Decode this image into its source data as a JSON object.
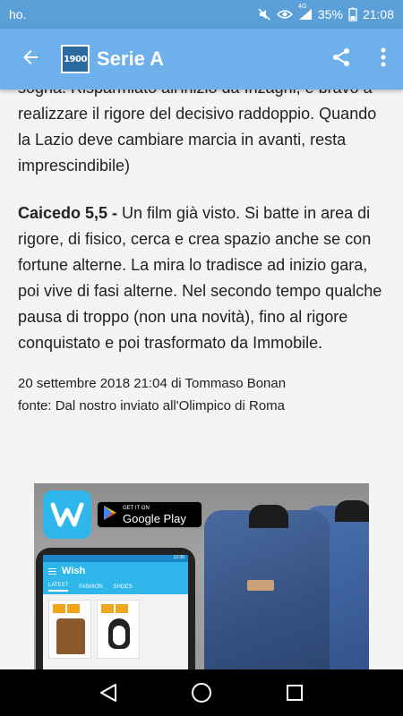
{
  "status_bar": {
    "carrier": "ho.",
    "network": "4G",
    "battery": "35%",
    "time": "21:08"
  },
  "app_bar": {
    "logo_text": "1900",
    "title": "Serie A"
  },
  "article": {
    "para1": "sogna. Risparmiato all'inizio da Inzaghi, è bravo a realizzare il rigore del decisivo raddoppio. Quando la Lazio deve cambiare marcia in avanti, resta imprescindibile)",
    "para2_name": "Caicedo 5,5 -",
    "para2_text": " Un film già visto. Si batte in area di rigore, di fisico, cerca e crea spazio anche se con fortune alterne. La mira lo tradisce ad inizio gara, poi vive di fasi alterne. Nel secondo tempo qualche pausa di troppo (non una novità), fino al rigore conquistato e poi trasformato da Immobile.",
    "meta_date_author": "20 settembre 2018 21:04 di Tommaso Bonan",
    "meta_source": "fonte: Dal nostro inviato all'Olimpico di Roma"
  },
  "ad": {
    "gplay_small": "GET IT ON",
    "gplay_big": "Google Play",
    "phone_brand": "Wish",
    "phone_time": "12:30",
    "phone_tabs": [
      "LATEST",
      "FASHION",
      "SHOES"
    ]
  },
  "icons": {
    "back": "arrow-left-icon",
    "share": "share-icon",
    "more": "more-vert-icon",
    "nav_back": "triangle-back-icon",
    "nav_home": "circle-home-icon",
    "nav_recents": "square-recents-icon"
  },
  "colors": {
    "status_bar": "#5a9fd8",
    "app_bar": "#6db0ec",
    "page_bg": "#f4f4f4",
    "wish_blue": "#2fb7ec"
  }
}
